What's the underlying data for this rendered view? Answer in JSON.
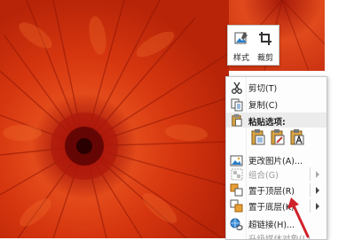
{
  "mini_toolbar": {
    "style_label": "样式",
    "crop_label": "裁剪"
  },
  "context_menu": {
    "cut": "剪切(T)",
    "copy": "复制(C)",
    "paste_header": "粘贴选项:",
    "change_picture": "更改图片(A)...",
    "group": "组合(G)",
    "bring_to_front": "置于顶层(R)",
    "send_to_back": "置于底层(K)",
    "hyperlink": "超链接(H)...",
    "more": "升级媒体对象(L)"
  },
  "colors": {
    "photo_red": "#c5280b",
    "annotation_arrow": "#d0222a"
  }
}
